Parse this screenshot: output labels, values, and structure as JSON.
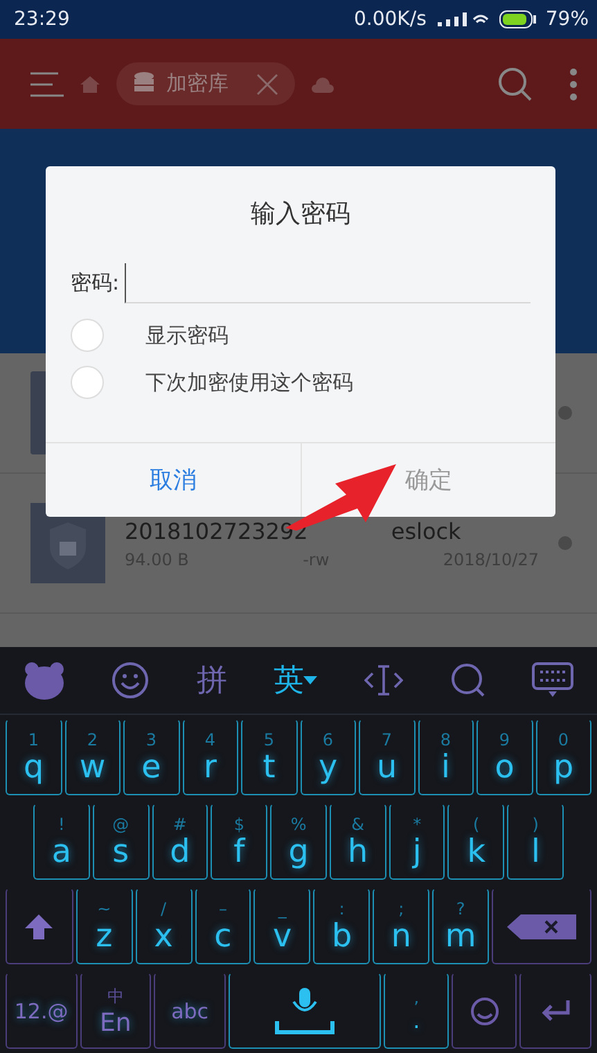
{
  "status_bar": {
    "time": "23:29",
    "net_speed": "0.00K/s",
    "battery": "79%"
  },
  "toolbar": {
    "breadcrumb": "加密库"
  },
  "files": [
    {
      "kind": "hidden"
    },
    {
      "kind": "file",
      "name_start": "2018102723292",
      "name_end": "eslock",
      "size": "94.00 B",
      "perm": "-rw",
      "date": "2018/10/27"
    }
  ],
  "dialog": {
    "title": "输入密码",
    "field_label": "密码:",
    "options": [
      {
        "label": "显示密码",
        "checked": false
      },
      {
        "label": "下次加密使用这个密码",
        "checked": false
      }
    ],
    "buttons": [
      {
        "label": "取消",
        "disabled": false
      },
      {
        "label": "确定",
        "disabled": true
      }
    ]
  },
  "keyboard": {
    "modes": [
      {
        "label": "拼",
        "selected": false
      },
      {
        "label": "英",
        "selected": true
      }
    ],
    "rows": [
      [
        {
          "kind": "letter",
          "label": "q",
          "hint": "1"
        },
        {
          "kind": "letter",
          "label": "w",
          "hint": "2"
        },
        {
          "kind": "letter",
          "label": "e",
          "hint": "3"
        },
        {
          "kind": "letter",
          "label": "r",
          "hint": "4"
        },
        {
          "kind": "letter",
          "label": "t",
          "hint": "5"
        },
        {
          "kind": "letter",
          "label": "y",
          "hint": "6"
        },
        {
          "kind": "letter",
          "label": "u",
          "hint": "7"
        },
        {
          "kind": "letter",
          "label": "i",
          "hint": "8"
        },
        {
          "kind": "letter",
          "label": "o",
          "hint": "9"
        },
        {
          "kind": "letter",
          "label": "p",
          "hint": "0"
        }
      ],
      [
        {
          "kind": "letter",
          "label": "a",
          "hint": "!"
        },
        {
          "kind": "letter",
          "label": "s",
          "hint": "@"
        },
        {
          "kind": "letter",
          "label": "d",
          "hint": "#"
        },
        {
          "kind": "letter",
          "label": "f",
          "hint": "$"
        },
        {
          "kind": "letter",
          "label": "g",
          "hint": "%"
        },
        {
          "kind": "letter",
          "label": "h",
          "hint": "&"
        },
        {
          "kind": "letter",
          "label": "j",
          "hint": "*"
        },
        {
          "kind": "letter",
          "label": "k",
          "hint": "("
        },
        {
          "kind": "letter",
          "label": "l",
          "hint": ")"
        }
      ],
      [
        {
          "kind": "shift"
        },
        {
          "kind": "letter",
          "label": "z",
          "hint": "~"
        },
        {
          "kind": "letter",
          "label": "x",
          "hint": "/"
        },
        {
          "kind": "letter",
          "label": "c",
          "hint": "–"
        },
        {
          "kind": "letter",
          "label": "v",
          "hint": "_"
        },
        {
          "kind": "letter",
          "label": "b",
          "hint": ":"
        },
        {
          "kind": "letter",
          "label": "n",
          "hint": ";"
        },
        {
          "kind": "letter",
          "label": "m",
          "hint": "?"
        },
        {
          "kind": "backspace"
        }
      ],
      [
        {
          "kind": "func",
          "label": "12.@"
        },
        {
          "kind": "lang",
          "label": "En",
          "hint": "中"
        },
        {
          "kind": "func",
          "label": "abc"
        },
        {
          "kind": "space"
        },
        {
          "kind": "punct",
          "label": ".",
          "hint": ","
        },
        {
          "kind": "emoji"
        },
        {
          "kind": "enter"
        }
      ]
    ]
  }
}
